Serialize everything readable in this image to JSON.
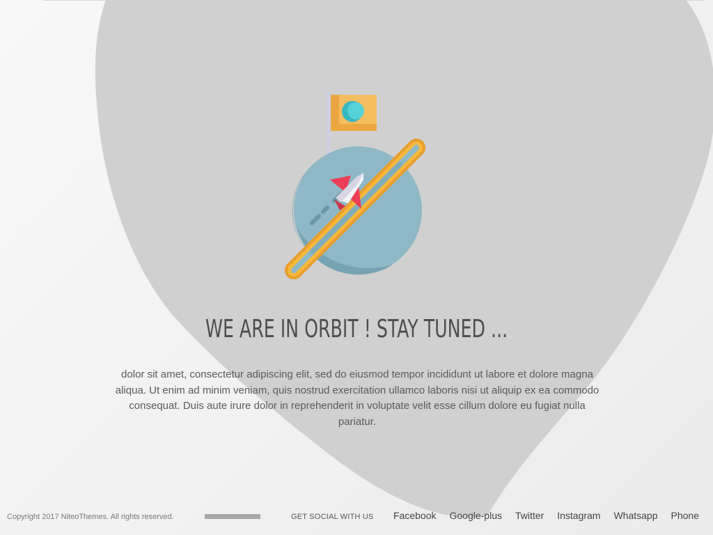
{
  "headline": "WE ARE IN ORBIT ! STAY TUNED ...",
  "description": "dolor sit amet, consectetur adipiscing elit, sed do eiusmod tempor incididunt ut labore et dolore magna aliqua. Ut enim ad minim veniam, quis nostrud exercitation ullamco laboris nisi ut aliquip ex ea commodo consequat. Duis aute irure dolor in reprehenderit in voluptate velit esse cillum dolore eu fugiat nulla pariatur.",
  "footer": {
    "copyright": "Copyright 2017 NiteoThemes. All rights reserved.",
    "social_heading": "GET SOCIAL WITH US",
    "social_links": [
      {
        "label": "Facebook"
      },
      {
        "label": "Google-plus"
      },
      {
        "label": "Twitter"
      },
      {
        "label": "Instagram"
      },
      {
        "label": "Whatsapp"
      },
      {
        "label": "Phone"
      }
    ]
  },
  "illustration": {
    "icon": "planet-with-flag-and-rocket-icon"
  },
  "colors": {
    "background": "#f4f4f4",
    "blob": "#d0d0d0",
    "planet": "#8fb8c6",
    "planet_shadow": "#77a4b3",
    "ring": "#f5b840",
    "ring_dark": "#e99e2b",
    "flag": "#f4bd5e",
    "flag_dot": "#4cc9cf",
    "rocket": "#ec3f55",
    "pole": "#cfcfe0"
  }
}
